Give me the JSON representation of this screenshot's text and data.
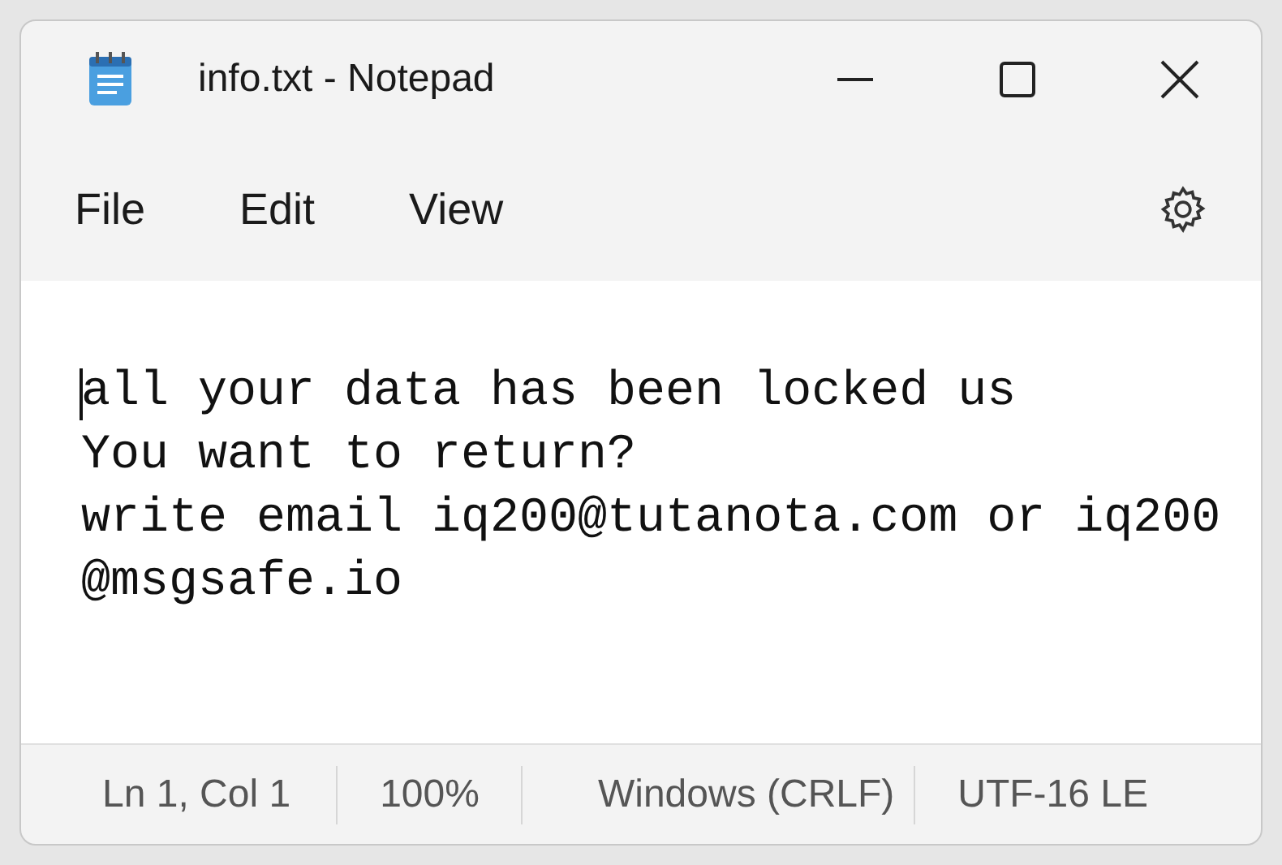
{
  "window": {
    "title": "info.txt - Notepad"
  },
  "menu": [
    "File",
    "Edit",
    "View"
  ],
  "editor": {
    "lines": [
      "all your data has been locked us",
      "You want to return?",
      "write email iq200@tutanota.com or iq200",
      "@msgsafe.io"
    ]
  },
  "status_bar": [
    "Ln 1, Col 1",
    "100%",
    "Windows (CRLF)",
    "UTF-16 LE"
  ]
}
